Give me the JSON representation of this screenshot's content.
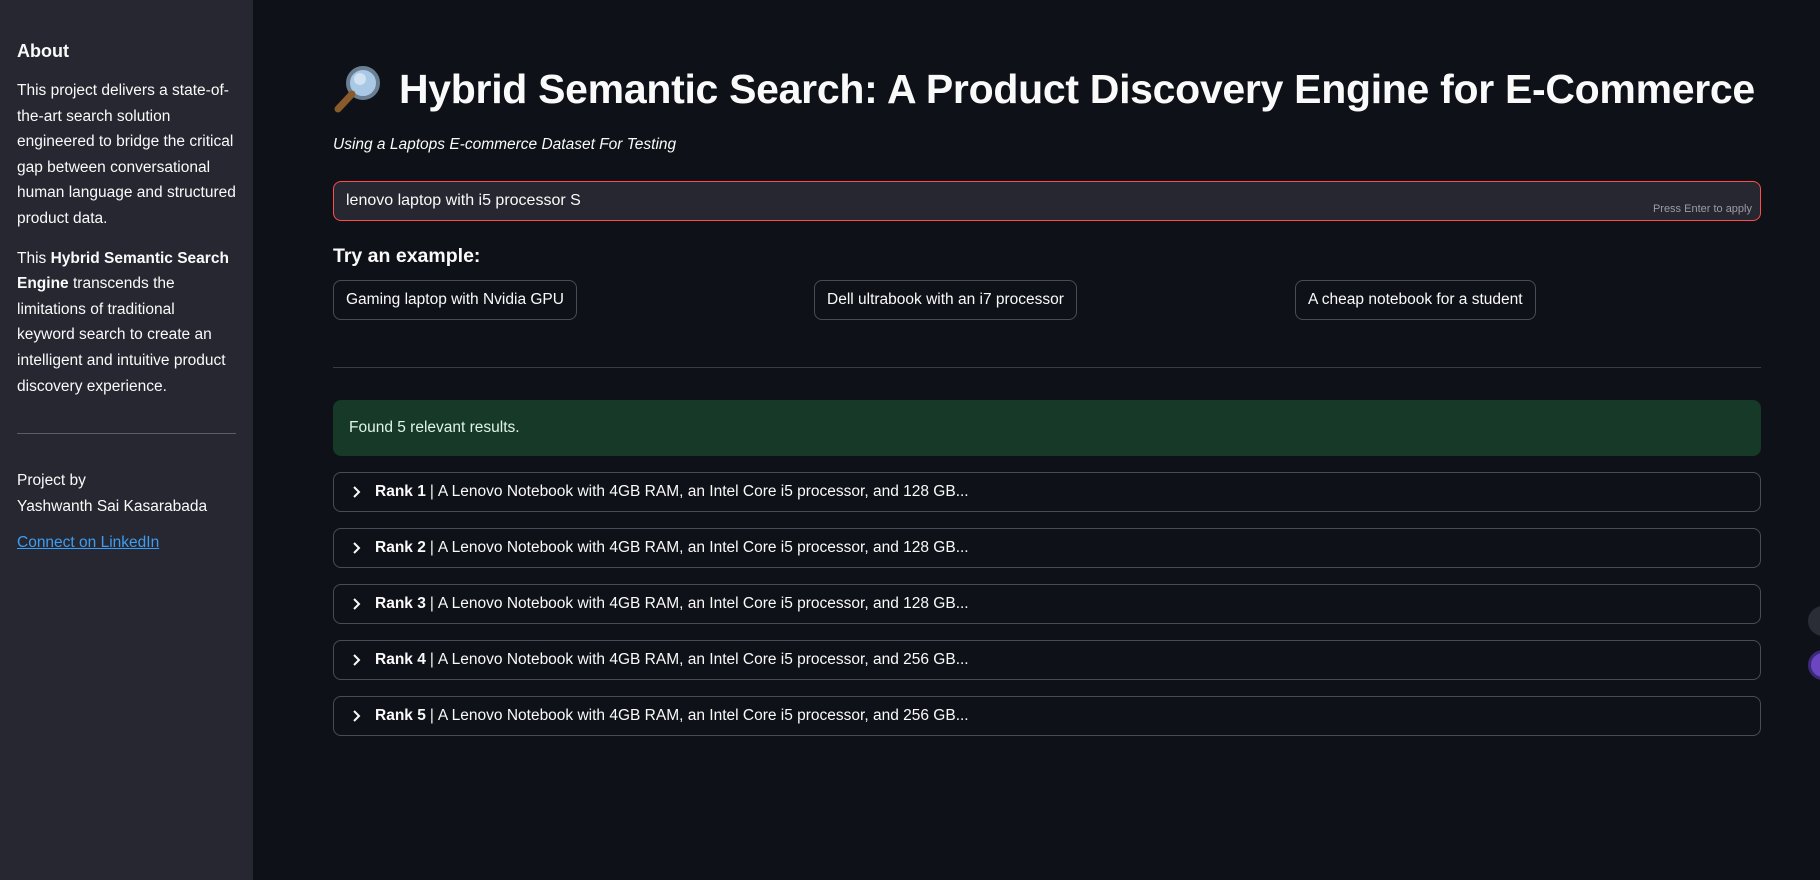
{
  "sidebar": {
    "heading": "About",
    "para1": "This project delivers a state-of-the-art search solution engineered to bridge the critical gap between conversational human language and structured product data.",
    "para2_prefix": "This ",
    "para2_bold": "Hybrid Semantic Search Engine",
    "para2_suffix": " transcends the limitations of traditional keyword search to create an intelligent and intuitive product discovery experience.",
    "credit_label": "Project by",
    "credit_name": "Yashwanth Sai Kasarabada",
    "link_label": "Connect on LinkedIn"
  },
  "main": {
    "title": "Hybrid Semantic Search: A Product Discovery Engine for E-Commerce",
    "title_icon": "magnifying-glass-icon",
    "subtitle": "Using a Laptops E-commerce Dataset For Testing",
    "search": {
      "value": "lenovo laptop with i5 processor S",
      "hint": "Press Enter to apply"
    },
    "examples_title": "Try an example:",
    "examples": [
      "Gaming laptop with Nvidia GPU",
      "Dell ultrabook with an i7 processor",
      "A cheap notebook for a student"
    ],
    "success_message": "Found 5 relevant results.",
    "results": [
      {
        "rank": "Rank 1",
        "text": "A Lenovo Notebook with 4GB RAM, an Intel Core i5 processor, and 128 GB..."
      },
      {
        "rank": "Rank 2",
        "text": "A Lenovo Notebook with 4GB RAM, an Intel Core i5 processor, and 128 GB..."
      },
      {
        "rank": "Rank 3",
        "text": "A Lenovo Notebook with 4GB RAM, an Intel Core i5 processor, and 128 GB..."
      },
      {
        "rank": "Rank 4",
        "text": "A Lenovo Notebook with 4GB RAM, an Intel Core i5 processor, and 256 GB..."
      },
      {
        "rank": "Rank 5",
        "text": "A Lenovo Notebook with 4GB RAM, an Intel Core i5 processor, and 256 GB..."
      }
    ],
    "separator": "|"
  },
  "colors": {
    "background": "#0e1117",
    "sidebar": "#262730",
    "accent_red": "#ff4b4b",
    "success_bg": "#173928",
    "link": "#3d9df3"
  }
}
